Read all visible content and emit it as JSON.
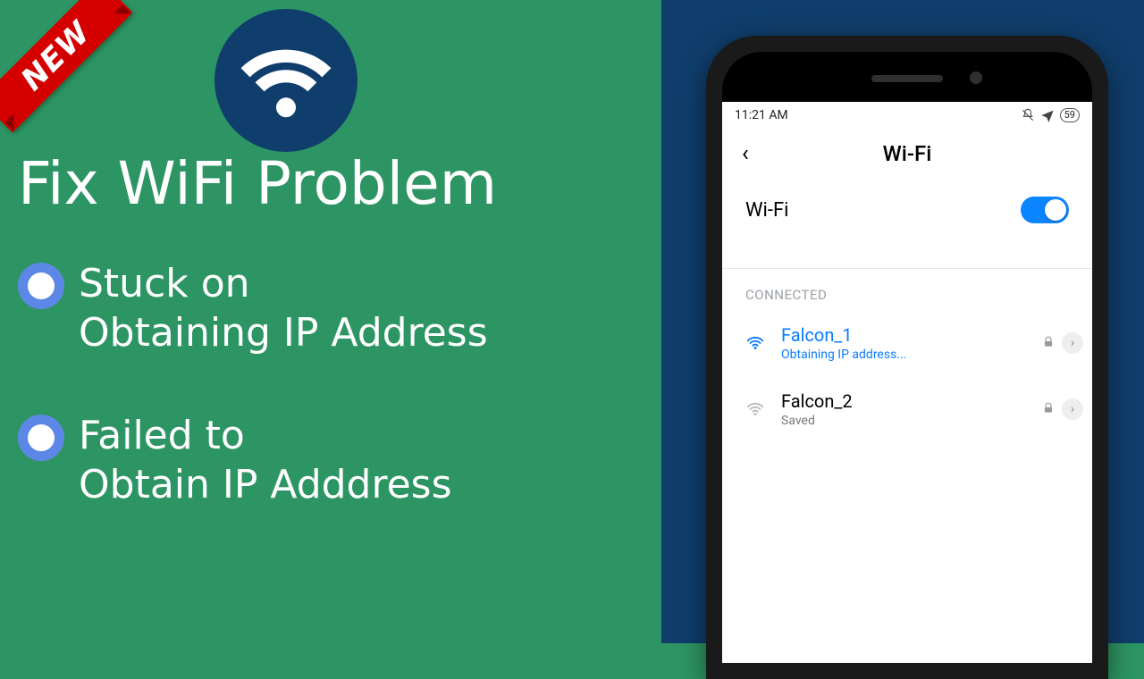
{
  "badge_text": "NEW",
  "title": "Fix WiFi Problem",
  "bullets": [
    {
      "line1": "Stuck on",
      "line2": "Obtaining IP Address"
    },
    {
      "line1": "Failed to",
      "line2": "Obtain IP Adddress"
    }
  ],
  "phone": {
    "status_time": "11:21 AM",
    "battery_text": "59",
    "header_title": "Wi-Fi",
    "wifi_toggle_label": "Wi-Fi",
    "wifi_toggle_on": true,
    "section_label": "CONNECTED",
    "networks": [
      {
        "name": "Falcon_1",
        "subtitle": "Obtaining IP address...",
        "active": true,
        "secured": true
      },
      {
        "name": "Falcon_2",
        "subtitle": "Saved",
        "active": false,
        "secured": true
      }
    ]
  }
}
